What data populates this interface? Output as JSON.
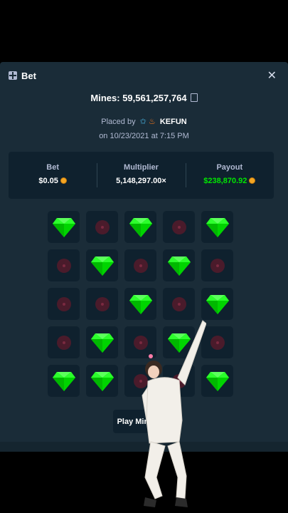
{
  "header": {
    "title": "Bet",
    "close_symbol": "✕"
  },
  "mines": {
    "label": "Mines: ",
    "id": "59,561,257,764"
  },
  "placed": {
    "prefix": "Placed by",
    "user": "KEFUN",
    "date_line": "on 10/23/2021 at 7:15 PM"
  },
  "stats": {
    "bet_label": "Bet",
    "bet_value": "$0.05",
    "multiplier_label": "Multiplier",
    "multiplier_value": "5,148,297.00×",
    "payout_label": "Payout",
    "payout_value": "$238,870.92"
  },
  "grid": [
    [
      "gem",
      "mine",
      "gem",
      "mine",
      "gem"
    ],
    [
      "mine",
      "gem",
      "mine",
      "gem",
      "mine"
    ],
    [
      "mine",
      "mine",
      "gem",
      "mine",
      "gem"
    ],
    [
      "mine",
      "gem",
      "mine",
      "gem",
      "mine"
    ],
    [
      "gem",
      "gem",
      "mine",
      "mine",
      "gem"
    ]
  ],
  "play_button": "Play Mines",
  "colors": {
    "background": "#1a2c38",
    "panel": "#0f212e",
    "payout": "#00e701",
    "gem": "#00e701"
  }
}
